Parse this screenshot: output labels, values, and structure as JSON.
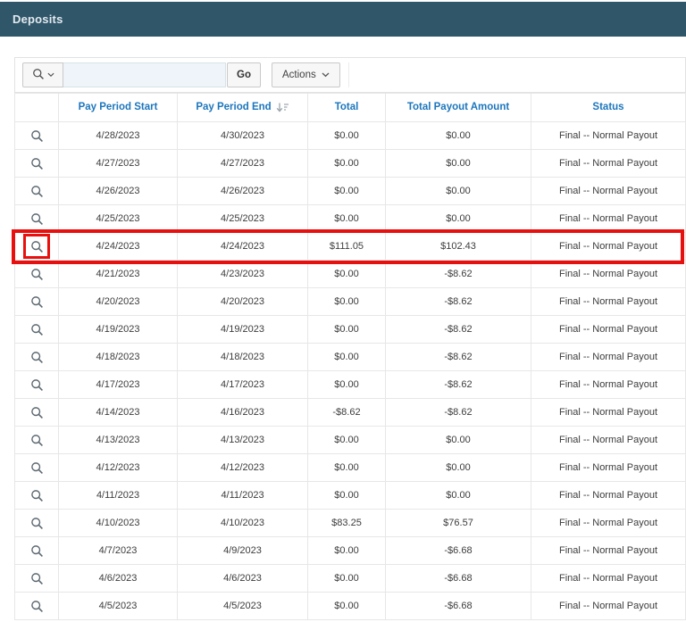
{
  "region": {
    "title": "Deposits"
  },
  "toolbar": {
    "search_input": {
      "value": "",
      "placeholder": ""
    },
    "go_label": "Go",
    "actions_label": "Actions"
  },
  "table": {
    "columns": [
      {
        "key": "icon",
        "label": ""
      },
      {
        "key": "start",
        "label": "Pay Period Start"
      },
      {
        "key": "end",
        "label": "Pay Period End",
        "sorted": "desc"
      },
      {
        "key": "total",
        "label": "Total"
      },
      {
        "key": "payout",
        "label": "Total Payout Amount"
      },
      {
        "key": "status",
        "label": "Status"
      }
    ],
    "rows": [
      {
        "start": "4/28/2023",
        "end": "4/30/2023",
        "total": "$0.00",
        "payout": "$0.00",
        "status": "Final -- Normal Payout"
      },
      {
        "start": "4/27/2023",
        "end": "4/27/2023",
        "total": "$0.00",
        "payout": "$0.00",
        "status": "Final -- Normal Payout"
      },
      {
        "start": "4/26/2023",
        "end": "4/26/2023",
        "total": "$0.00",
        "payout": "$0.00",
        "status": "Final -- Normal Payout"
      },
      {
        "start": "4/25/2023",
        "end": "4/25/2023",
        "total": "$0.00",
        "payout": "$0.00",
        "status": "Final -- Normal Payout"
      },
      {
        "start": "4/24/2023",
        "end": "4/24/2023",
        "total": "$111.05",
        "payout": "$102.43",
        "status": "Final -- Normal Payout"
      },
      {
        "start": "4/21/2023",
        "end": "4/23/2023",
        "total": "$0.00",
        "payout": "-$8.62",
        "status": "Final -- Normal Payout"
      },
      {
        "start": "4/20/2023",
        "end": "4/20/2023",
        "total": "$0.00",
        "payout": "-$8.62",
        "status": "Final -- Normal Payout"
      },
      {
        "start": "4/19/2023",
        "end": "4/19/2023",
        "total": "$0.00",
        "payout": "-$8.62",
        "status": "Final -- Normal Payout"
      },
      {
        "start": "4/18/2023",
        "end": "4/18/2023",
        "total": "$0.00",
        "payout": "-$8.62",
        "status": "Final -- Normal Payout"
      },
      {
        "start": "4/17/2023",
        "end": "4/17/2023",
        "total": "$0.00",
        "payout": "-$8.62",
        "status": "Final -- Normal Payout"
      },
      {
        "start": "4/14/2023",
        "end": "4/16/2023",
        "total": "-$8.62",
        "payout": "-$8.62",
        "status": "Final -- Normal Payout"
      },
      {
        "start": "4/13/2023",
        "end": "4/13/2023",
        "total": "$0.00",
        "payout": "$0.00",
        "status": "Final -- Normal Payout"
      },
      {
        "start": "4/12/2023",
        "end": "4/12/2023",
        "total": "$0.00",
        "payout": "$0.00",
        "status": "Final -- Normal Payout"
      },
      {
        "start": "4/11/2023",
        "end": "4/11/2023",
        "total": "$0.00",
        "payout": "$0.00",
        "status": "Final -- Normal Payout"
      },
      {
        "start": "4/10/2023",
        "end": "4/10/2023",
        "total": "$83.25",
        "payout": "$76.57",
        "status": "Final -- Normal Payout"
      },
      {
        "start": "4/7/2023",
        "end": "4/9/2023",
        "total": "$0.00",
        "payout": "-$6.68",
        "status": "Final -- Normal Payout"
      },
      {
        "start": "4/6/2023",
        "end": "4/6/2023",
        "total": "$0.00",
        "payout": "-$6.68",
        "status": "Final -- Normal Payout"
      },
      {
        "start": "4/5/2023",
        "end": "4/5/2023",
        "total": "$0.00",
        "payout": "-$6.68",
        "status": "Final -- Normal Payout"
      }
    ],
    "highlighted_row_index": 4
  },
  "colors": {
    "region_bar": "#30566a",
    "column_header_text": "#1c76bd",
    "annotation_red": "#e8100e",
    "grid_border": "#e7e7e7",
    "magnifier": "#5b6770"
  }
}
